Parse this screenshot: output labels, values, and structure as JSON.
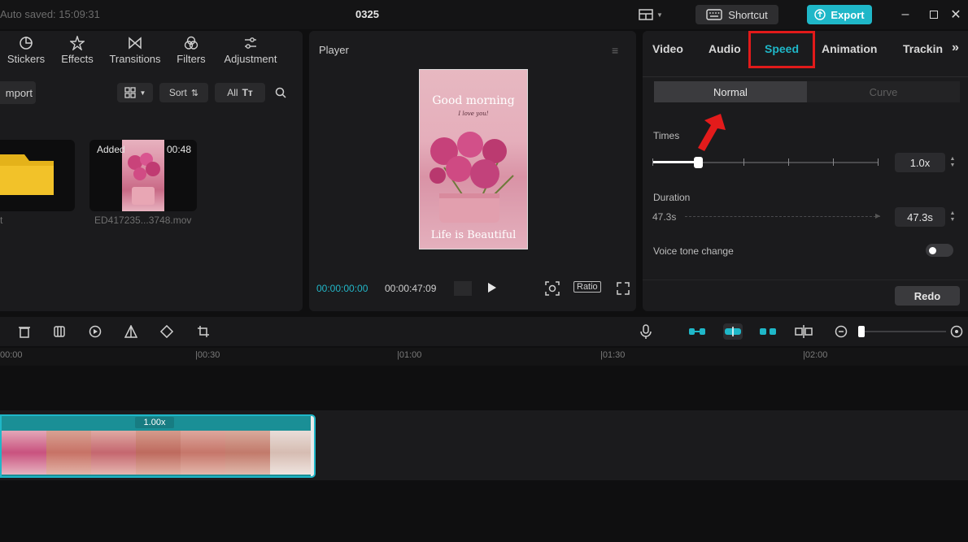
{
  "titlebar": {
    "autosave": "Auto saved: 15:09:31",
    "project_title": "0325",
    "shortcut_label": "Shortcut",
    "export_label": "Export"
  },
  "media": {
    "tabs": [
      {
        "label": "Stickers",
        "icon": "sticker-icon"
      },
      {
        "label": "Effects",
        "icon": "effects-icon"
      },
      {
        "label": "Transitions",
        "icon": "transitions-icon"
      },
      {
        "label": "Filters",
        "icon": "filters-icon"
      },
      {
        "label": "Adjustment",
        "icon": "adjustment-icon"
      }
    ],
    "import_label": "mport",
    "sort_label": "Sort",
    "all_label": "All",
    "filter_glyph": "Tт",
    "folder_name": "t",
    "video": {
      "added_label": "Added",
      "duration": "00:48",
      "file_name": "ED417235...3748.mov"
    }
  },
  "player": {
    "label": "Player",
    "preview_top": "Good morning",
    "preview_sub": "I love you!",
    "preview_bottom": "Life is Beautiful",
    "time_current": "00:00:00:00",
    "time_total": "00:00:47:09",
    "ratio_label": "Ratio"
  },
  "speed_panel": {
    "tabs": [
      "Video",
      "Audio",
      "Speed",
      "Animation",
      "Trackin"
    ],
    "active_tab": "Speed",
    "more_glyph": "»",
    "segments": {
      "normal": "Normal",
      "curve": "Curve"
    },
    "times_label": "Times",
    "times_value": "1.0x",
    "duration_label": "Duration",
    "duration_start": "47.3s",
    "duration_value": "47.3s",
    "voice_tone_label": "Voice tone change",
    "redo_label": "Redo",
    "accent_color": "#1fb7c8",
    "highlight_color": "#e11a1a"
  },
  "timeline": {
    "ruler": [
      "00:00",
      "|00:30",
      "|01:00",
      "|01:30",
      "|02:00"
    ],
    "clip_speed": "1.00x"
  }
}
